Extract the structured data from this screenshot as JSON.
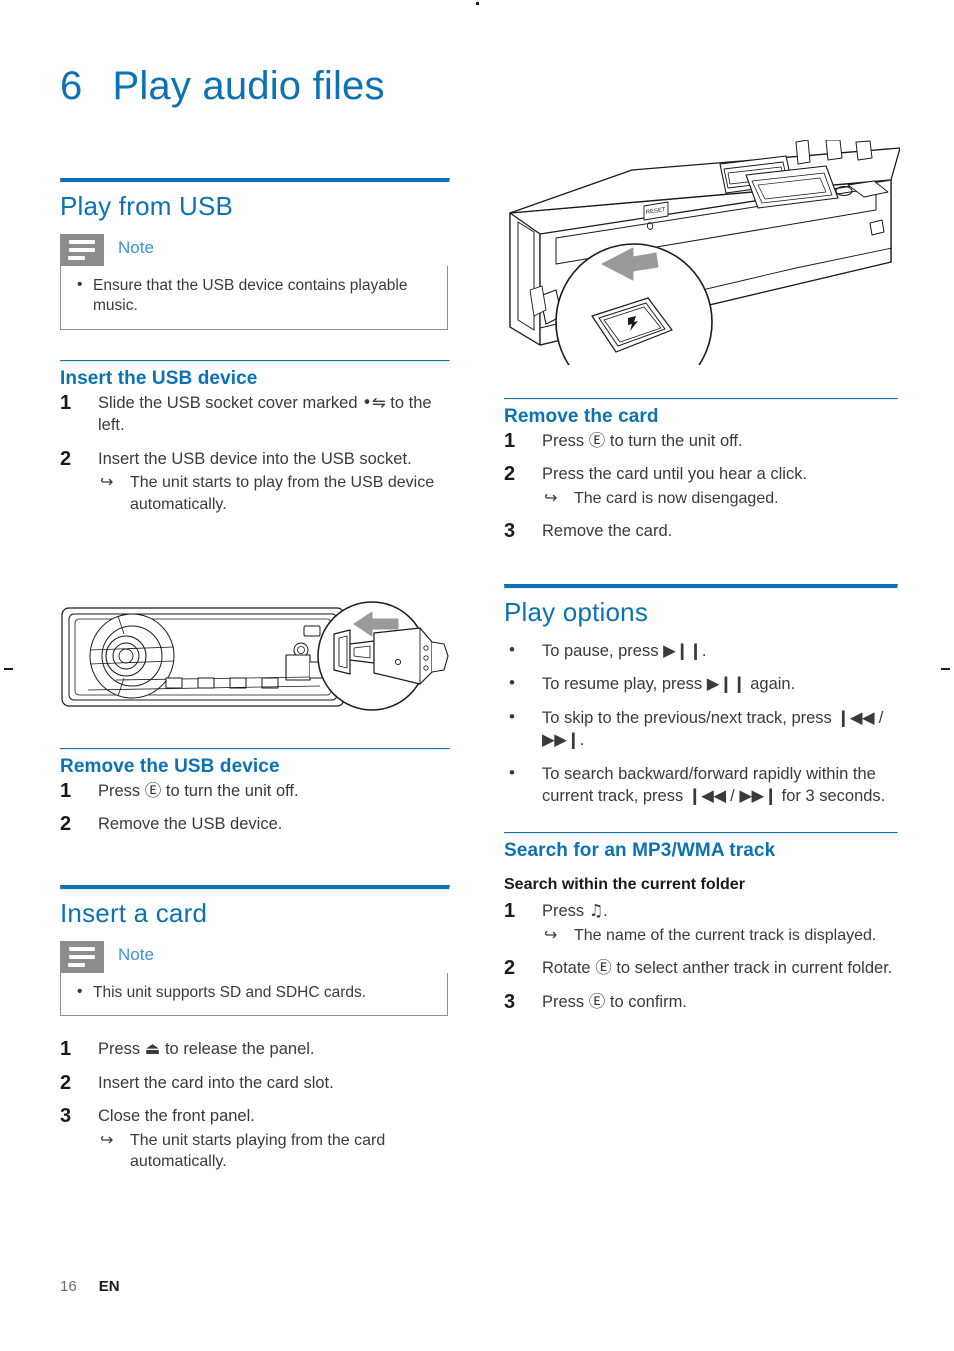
{
  "page": {
    "chapter_number": "6",
    "chapter_title": "Play audio files",
    "footer_page": "16",
    "footer_lang": "EN",
    "accent_color": "#0a72b5",
    "note_icon_color": "#8c8c8c",
    "body_color": "#3a3a3a"
  },
  "left_column": {
    "section_usb": {
      "title": "Play from USB",
      "note": {
        "icon": "note-lines-icon",
        "label": "Note",
        "items": [
          "Ensure that the USB device contains playable music."
        ]
      },
      "insert": {
        "title": "Insert the USB device",
        "steps": [
          {
            "num": "1",
            "text_before": "Slide the USB socket cover marked",
            "symbol": "•⇋",
            "symbol_name": "usb-icon",
            "text_after": "to the left."
          },
          {
            "num": "2",
            "text_before": "Insert the USB device into the USB socket.",
            "symbol": "",
            "symbol_name": "",
            "text_after": "",
            "result": "The unit starts to play from the USB device automatically."
          }
        ]
      },
      "illustration_usb": "car-stereo-usb-insert-illustration",
      "remove": {
        "title": "Remove the USB device",
        "steps": [
          {
            "num": "1",
            "text_before": "Press",
            "symbol": "Ⓔ",
            "symbol_name": "power-knob-icon",
            "text_after": "to turn the unit off."
          },
          {
            "num": "2",
            "text_before": "Remove the USB device.",
            "symbol": "",
            "symbol_name": "",
            "text_after": ""
          }
        ]
      }
    },
    "section_card": {
      "title": "Insert a card",
      "note": {
        "icon": "note-lines-icon",
        "label": "Note",
        "items": [
          "This unit supports SD and SDHC cards."
        ]
      },
      "steps": [
        {
          "num": "1",
          "text_before": "Press",
          "symbol": "⏏",
          "symbol_name": "eject-icon",
          "text_after": "to release the panel."
        },
        {
          "num": "2",
          "text_before": "Insert the card into the card slot.",
          "symbol": "",
          "symbol_name": "",
          "text_after": ""
        },
        {
          "num": "3",
          "text_before": "Close the front panel.",
          "symbol": "",
          "symbol_name": "",
          "text_after": "",
          "result": "The unit starts playing from the card automatically."
        }
      ]
    }
  },
  "right_column": {
    "illustration_card": "car-stereo-open-panel-card-slot-illustration",
    "remove_card": {
      "title": "Remove the card",
      "steps": [
        {
          "num": "1",
          "text_before": "Press",
          "symbol": "Ⓔ",
          "symbol_name": "power-knob-icon",
          "text_after": "to turn the unit off."
        },
        {
          "num": "2",
          "text_before": "Press the card until you hear a click.",
          "symbol": "",
          "symbol_name": "",
          "text_after": "",
          "result": "The card is now disengaged."
        },
        {
          "num": "3",
          "text_before": "Remove the card.",
          "symbol": "",
          "symbol_name": "",
          "text_after": ""
        }
      ]
    },
    "play_options": {
      "title": "Play options",
      "items": [
        {
          "pre": "To pause, press",
          "sym1": "▶❙❙",
          "sym1_name": "play-pause-icon",
          "mid": "",
          "sym2": "",
          "sym2_name": "",
          "post": "."
        },
        {
          "pre": "To resume play, press",
          "sym1": "▶❙❙",
          "sym1_name": "play-pause-icon",
          "mid": "",
          "sym2": "",
          "sym2_name": "",
          "post": "again."
        },
        {
          "pre": "To skip to the previous/next track, press",
          "sym1": "❙◀◀",
          "sym1_name": "previous-track-icon",
          "mid": "/",
          "sym2": "▶▶❙",
          "sym2_name": "next-track-icon",
          "post": "."
        },
        {
          "pre": "To search backward/forward rapidly within the current track, press",
          "sym1": "❙◀◀",
          "sym1_name": "rewind-icon",
          "mid": "/",
          "sym2": "▶▶❙",
          "sym2_name": "fast-forward-icon",
          "post": "for 3 seconds."
        }
      ]
    },
    "search_track": {
      "title": "Search for an MP3/WMA track",
      "subtitle": "Search within the current folder",
      "steps": [
        {
          "num": "1",
          "text_before": "Press",
          "symbol": "♫",
          "symbol_name": "music-note-icon",
          "text_after": ".",
          "result": "The name of the current track is displayed."
        },
        {
          "num": "2",
          "text_before": "Rotate",
          "symbol": "Ⓔ",
          "symbol_name": "power-knob-icon",
          "text_after": "to select anther track in current folder."
        },
        {
          "num": "3",
          "text_before": "Press",
          "symbol": "Ⓔ",
          "symbol_name": "power-knob-icon",
          "text_after": "to confirm."
        }
      ]
    }
  }
}
